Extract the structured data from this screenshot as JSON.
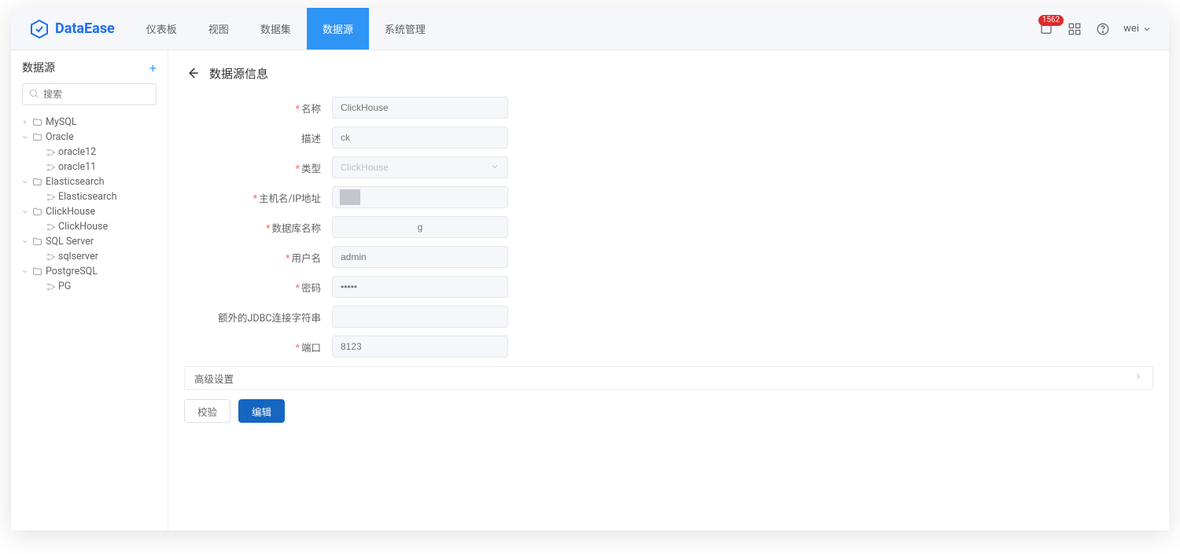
{
  "brand": {
    "name": "DataEase"
  },
  "nav": {
    "items": [
      "仪表板",
      "视图",
      "数据集",
      "数据源",
      "系统管理"
    ],
    "activeIndex": 3
  },
  "header": {
    "badgeCount": "1562",
    "userName": "wei"
  },
  "sidebar": {
    "title": "数据源",
    "searchPlaceholder": "搜索",
    "tree": [
      {
        "label": "MySQL",
        "expanded": false,
        "children": []
      },
      {
        "label": "Oracle",
        "expanded": true,
        "children": [
          "oracle12",
          "oracle11"
        ]
      },
      {
        "label": "Elasticsearch",
        "expanded": true,
        "children": [
          "Elasticsearch"
        ]
      },
      {
        "label": "ClickHouse",
        "expanded": true,
        "children": [
          "ClickHouse"
        ]
      },
      {
        "label": "SQL Server",
        "expanded": true,
        "children": [
          "sqlserver"
        ]
      },
      {
        "label": "PostgreSQL",
        "expanded": true,
        "children": [
          "PG"
        ]
      }
    ]
  },
  "page": {
    "title": "数据源信息",
    "advanced": "高级设置",
    "buttons": {
      "verify": "校验",
      "edit": "编辑"
    }
  },
  "form": {
    "fields": {
      "name": {
        "label": "名称",
        "value": "ClickHouse",
        "required": true
      },
      "desc": {
        "label": "描述",
        "value": "ck",
        "required": false
      },
      "type": {
        "label": "类型",
        "value": "ClickHouse",
        "required": true
      },
      "host": {
        "label": "主机名/IP地址",
        "value": "",
        "required": true
      },
      "db": {
        "label": "数据库名称",
        "value": "g",
        "required": true
      },
      "user": {
        "label": "用户名",
        "value": "admin",
        "required": true
      },
      "pass": {
        "label": "密码",
        "value": "•••••",
        "required": true
      },
      "jdbc": {
        "label": "额外的JDBC连接字符串",
        "value": "",
        "required": false
      },
      "port": {
        "label": "端口",
        "value": "8123",
        "required": true
      }
    }
  }
}
